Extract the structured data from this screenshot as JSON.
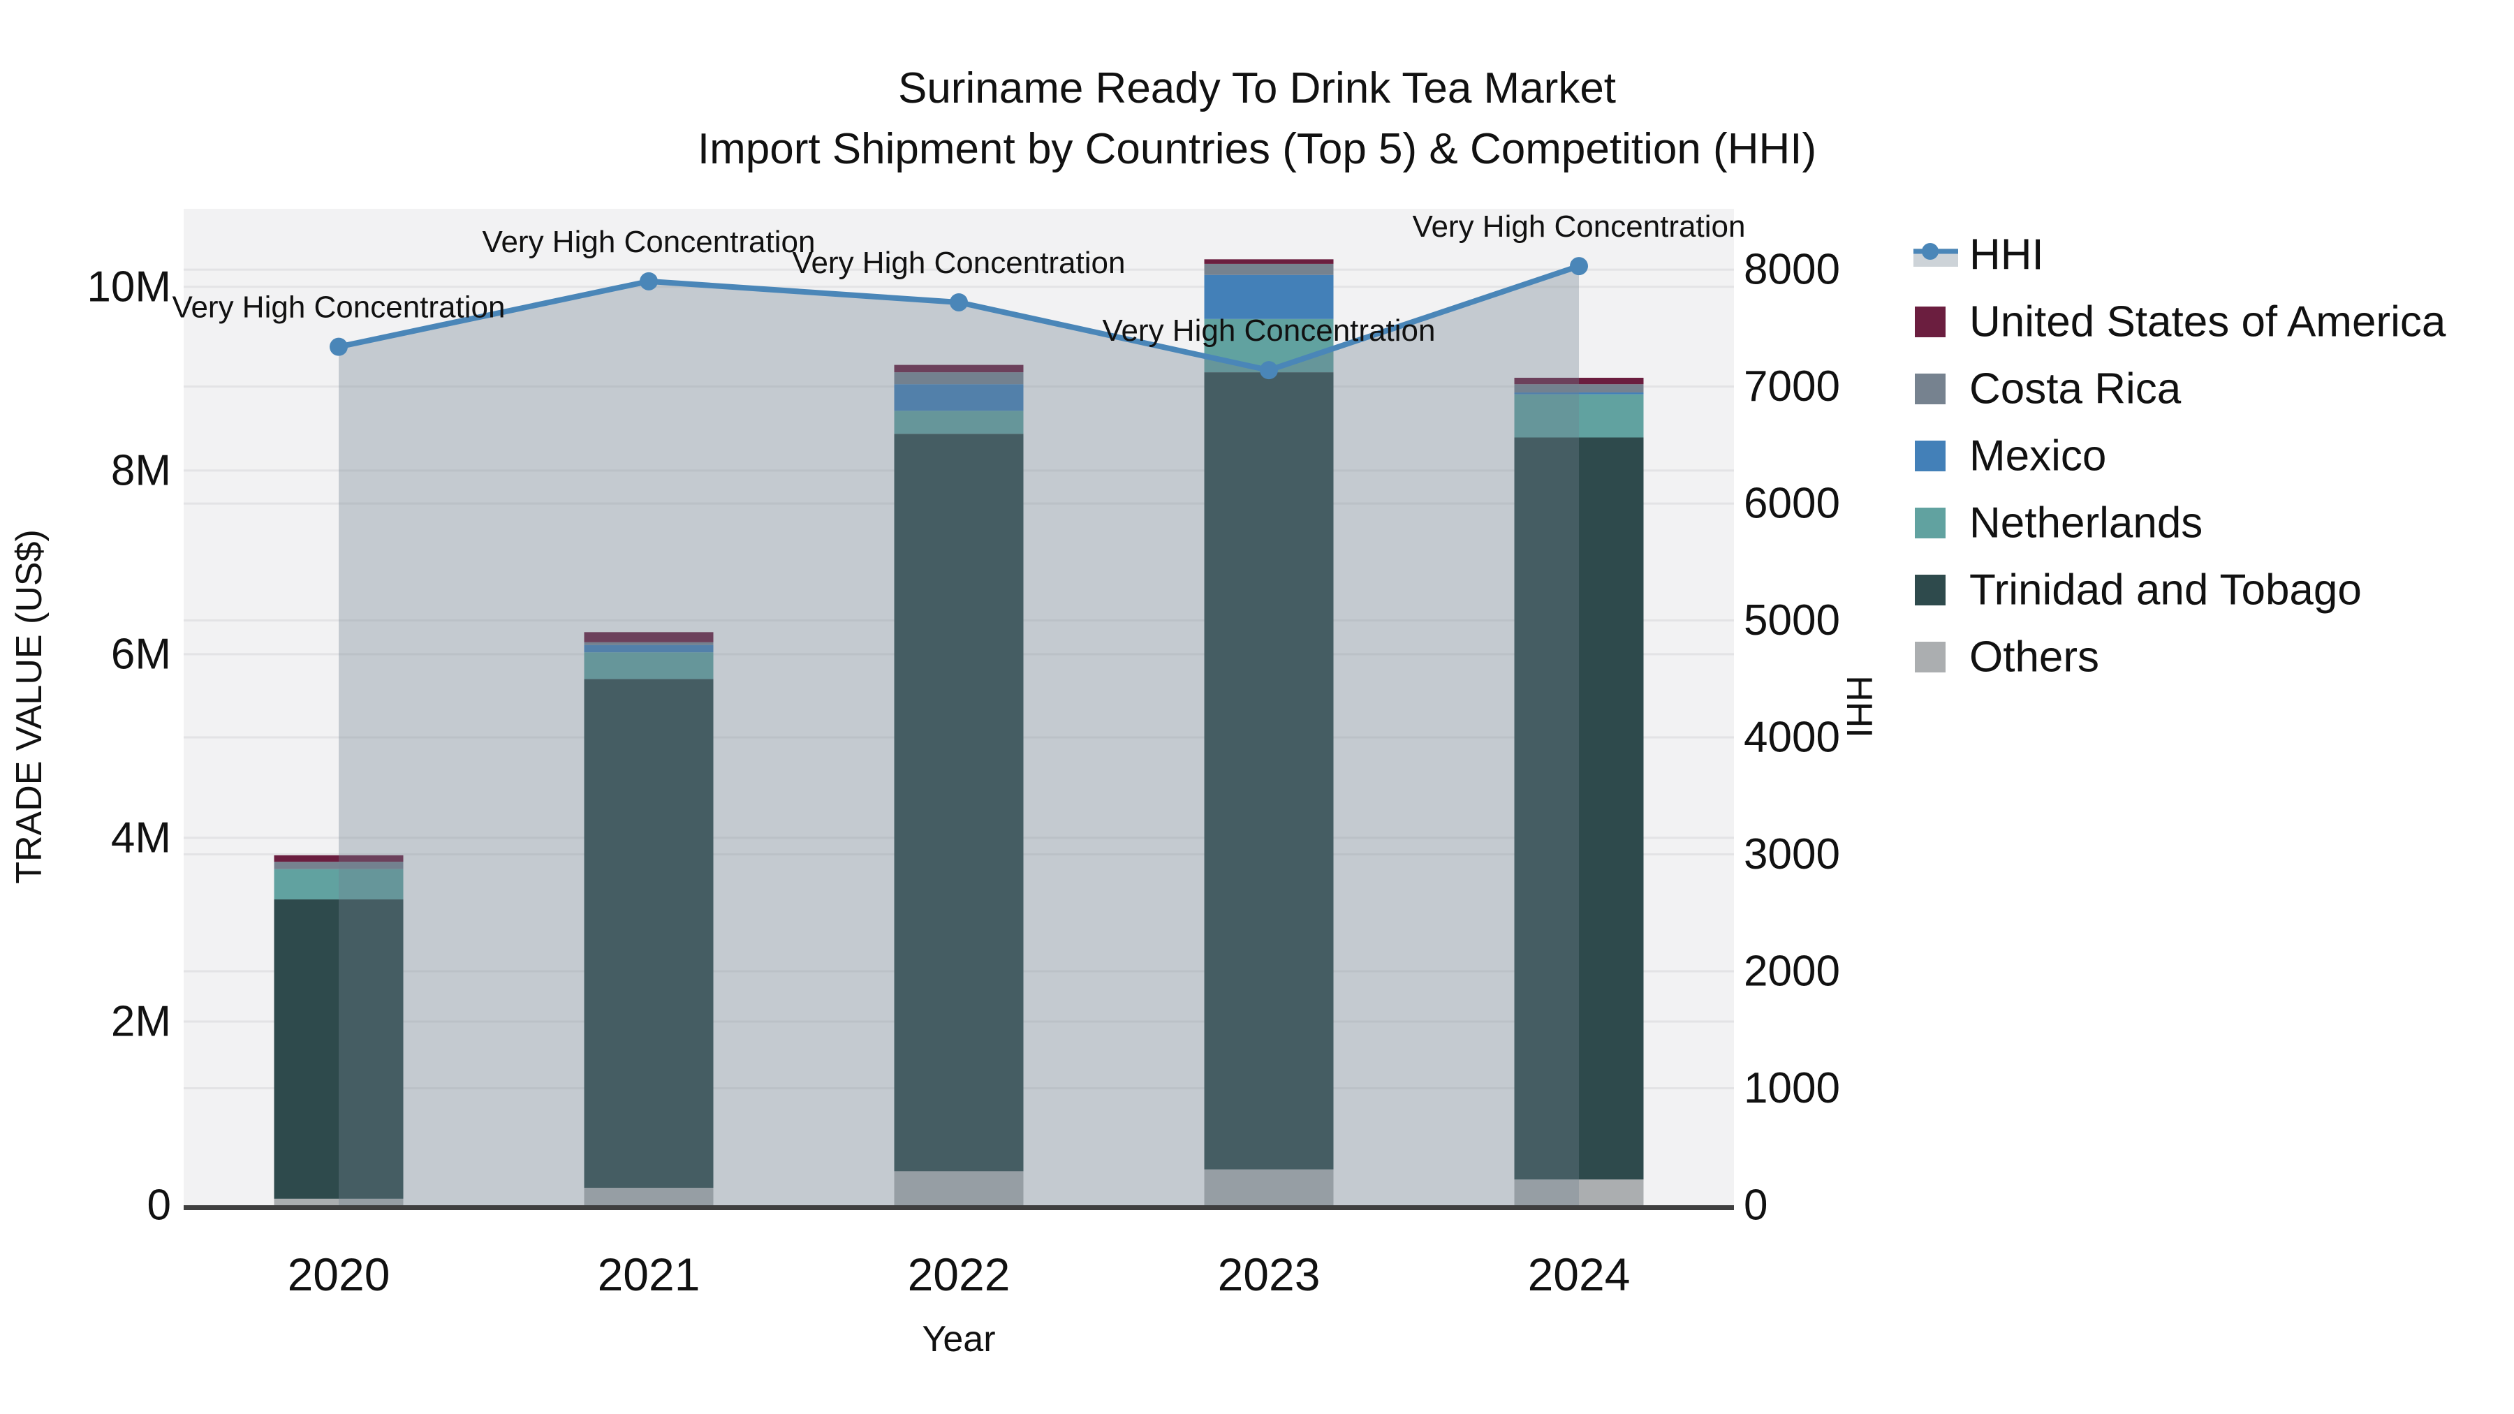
{
  "title": {
    "line1": "Suriname Ready To Drink Tea Market",
    "line2": "Import Shipment by Countries (Top 5) & Competition (HHI)"
  },
  "chart_data": {
    "type": "bar+line",
    "categories": [
      "2020",
      "2021",
      "2022",
      "2023",
      "2024"
    ],
    "bar_value_unit": "millions US$",
    "series": [
      {
        "name": "United States of America",
        "color": "#6b1e3f",
        "values": [
          0.07,
          0.11,
          0.08,
          0.05,
          0.07
        ]
      },
      {
        "name": "Costa Rica",
        "color": "#76828f",
        "values": [
          0.08,
          0.03,
          0.13,
          0.12,
          0.09
        ]
      },
      {
        "name": "Mexico",
        "color": "#4380b8",
        "values": [
          0.0,
          0.08,
          0.29,
          0.48,
          0.02
        ]
      },
      {
        "name": "Netherlands",
        "color": "#61a2a0",
        "values": [
          0.33,
          0.29,
          0.25,
          0.58,
          0.47
        ]
      },
      {
        "name": "Trinidad and Tobago",
        "color": "#2e4a4c",
        "values": [
          3.26,
          5.54,
          8.03,
          8.68,
          8.08
        ]
      },
      {
        "name": "Others",
        "color": "#abaeb0",
        "values": [
          0.07,
          0.19,
          0.37,
          0.39,
          0.28
        ]
      }
    ],
    "bar_totals": [
      3.81,
      6.24,
      9.15,
      10.3,
      9.01
    ],
    "line_series": {
      "name": "HHI",
      "color": "#4a86b8",
      "area_fill_color": "rgba(112,128,144,0.35)",
      "values": [
        7340,
        7900,
        7720,
        7140,
        8030
      ]
    },
    "annotations": [
      {
        "text": "Very High Concentration",
        "category": "2020"
      },
      {
        "text": "Very High Concentration",
        "category": "2021"
      },
      {
        "text": "Very High Concentration",
        "category": "2022"
      },
      {
        "text": "Very High Concentration",
        "category": "2023"
      },
      {
        "text": "Very High Concentration",
        "category": "2024"
      }
    ],
    "xlabel": "Year",
    "ylabel": "TRADE VALUE (US$)",
    "y2label": "HHI",
    "ytick_labels": [
      "0",
      "2M",
      "4M",
      "6M",
      "8M",
      "10M"
    ],
    "ytick_values": [
      0,
      2,
      4,
      6,
      8,
      10
    ],
    "y2tick_labels": [
      "0",
      "1000",
      "2000",
      "3000",
      "4000",
      "5000",
      "6000",
      "7000",
      "8000"
    ],
    "y2tick_values": [
      0,
      1000,
      2000,
      3000,
      4000,
      5000,
      6000,
      7000,
      8000
    ],
    "ylim": [
      0,
      10.85
    ],
    "y2lim": [
      0,
      8520
    ],
    "grid": true,
    "legend_position": "right",
    "legend_order": [
      "HHI",
      "United States of America",
      "Costa Rica",
      "Mexico",
      "Netherlands",
      "Trinidad and Tobago",
      "Others"
    ],
    "colors": {
      "plot_background": "#f2f2f3",
      "figure_background": "#ffffff",
      "gridline": "#e3e3e5",
      "axis_line": "#3f3f3f",
      "text": "#111111"
    }
  }
}
